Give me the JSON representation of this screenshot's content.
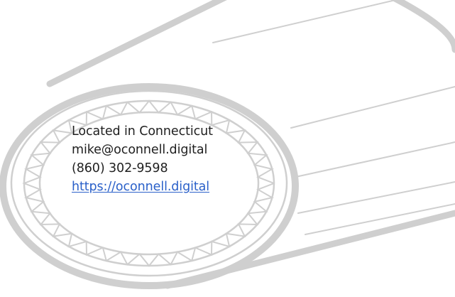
{
  "contact": {
    "location": "Located in Connecticut",
    "email": "mike@oconnell.digital",
    "phone": "(860) 302-9598",
    "website_label": "https://oconnell.digital",
    "website_href": "https://oconnell.digital"
  },
  "colors": {
    "text": "#1f1f1f",
    "link": "#2a60c9",
    "drawing_stroke": "#cfcfcf",
    "background": "#ffffff"
  },
  "icons": {
    "illustration": "rolled-belt-illustration"
  }
}
